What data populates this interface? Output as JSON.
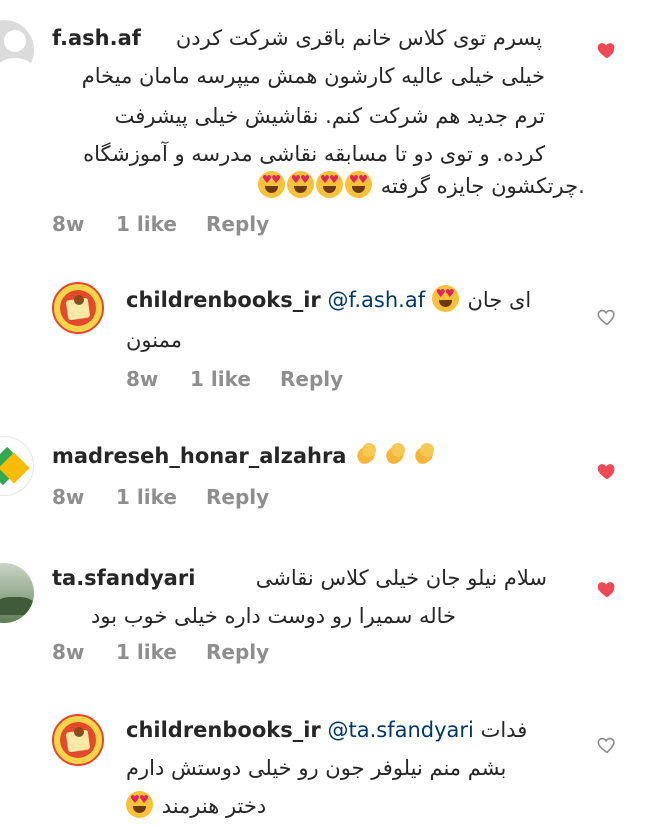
{
  "comments": [
    {
      "username": "f.ash.af",
      "lines": [
        "پسرم توی کلاس خانم باقری شرکت کردن",
        "خیلی خیلی عالیه کارشون همش میپرسه مامان میخام",
        "ترم جدید هم شرکت کنم. نقاشیش خیلی پیشرفت",
        "کرده. و توی دو تا مسابقه نقاشی مدرسه و آموزشگاه",
        ".چرتکشون جایزه گرفته"
      ],
      "meta": {
        "time": "8w",
        "likes": "1 like",
        "reply": "Reply"
      },
      "liked": true
    },
    {
      "username": "childrenbooks_ir",
      "mention": "@f.ash.af",
      "text_after_mention": "ای جان",
      "line2": "ممنون",
      "meta": {
        "time": "8w",
        "likes": "1 like",
        "reply": "Reply"
      },
      "liked": false
    },
    {
      "username": "madreseh_honar_alzahra",
      "meta": {
        "time": "8w",
        "likes": "1 like",
        "reply": "Reply"
      },
      "liked": true
    },
    {
      "username": "ta.sfandyari",
      "lines": [
        "سلام نیلو جان خیلی کلاس نقاشی",
        "خاله سمیرا رو دوست داره خیلی خوب بود"
      ],
      "meta": {
        "time": "8w",
        "likes": "1 like",
        "reply": "Reply"
      },
      "liked": true
    },
    {
      "username": "childrenbooks_ir",
      "mention": "@ta.sfandyari",
      "text_after_mention": "فدات",
      "line2": "بشم منم نیلوفر جون رو خیلی دوستش دارم",
      "line3": "دختر هنرمند",
      "liked": false
    }
  ],
  "colors": {
    "liked_heart": "#ed4956",
    "mention": "#00376b",
    "meta_gray": "#8e8e8e"
  },
  "icons": {
    "liked": "heart-filled-icon",
    "unliked": "heart-outline-icon"
  }
}
